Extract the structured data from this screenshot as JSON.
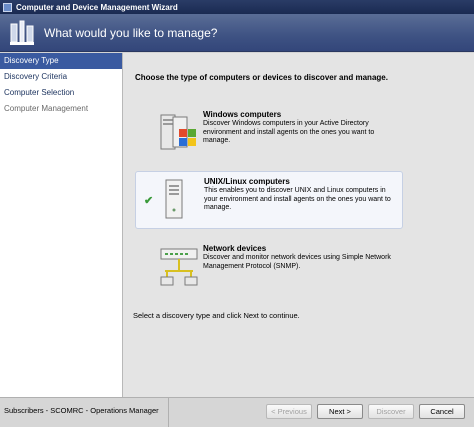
{
  "window": {
    "title": "Computer and Device Management Wizard"
  },
  "banner": {
    "text": "What would you like to manage?"
  },
  "sidebar": {
    "items": [
      {
        "label": "Discovery Type",
        "state": "active"
      },
      {
        "label": "Discovery Criteria",
        "state": "normal"
      },
      {
        "label": "Computer Selection",
        "state": "normal"
      },
      {
        "label": "Computer Management",
        "state": "muted"
      }
    ]
  },
  "main": {
    "heading": "Choose the type of computers or devices to discover and manage.",
    "options": [
      {
        "title": "Windows computers",
        "description": "Discover Windows computers in your Active Directory environment and install agents on the ones you want to manage.",
        "icon": "windows-computer-icon",
        "selected": false
      },
      {
        "title": "UNIX/Linux computers",
        "description": "This enables you to discover UNIX and Linux computers in your environment and install agents on the ones you want to manage.",
        "icon": "unix-computer-icon",
        "selected": true
      },
      {
        "title": "Network devices",
        "description": "Discover and monitor network devices using Simple Network Management Protocol (SNMP).",
        "icon": "network-device-icon",
        "selected": false
      }
    ],
    "hint": "Select a discovery type and click Next to continue."
  },
  "footer": {
    "status": "Subscribers - SCOMRC - Operations Manager",
    "buttons": {
      "previous": "< Previous",
      "next": "Next >",
      "discover": "Discover",
      "cancel": "Cancel"
    }
  },
  "colors": {
    "title_bar": "#1a2a52",
    "banner": "#3e5283",
    "sidebar_active": "#3a5aa0",
    "check": "#3a9a3a"
  }
}
